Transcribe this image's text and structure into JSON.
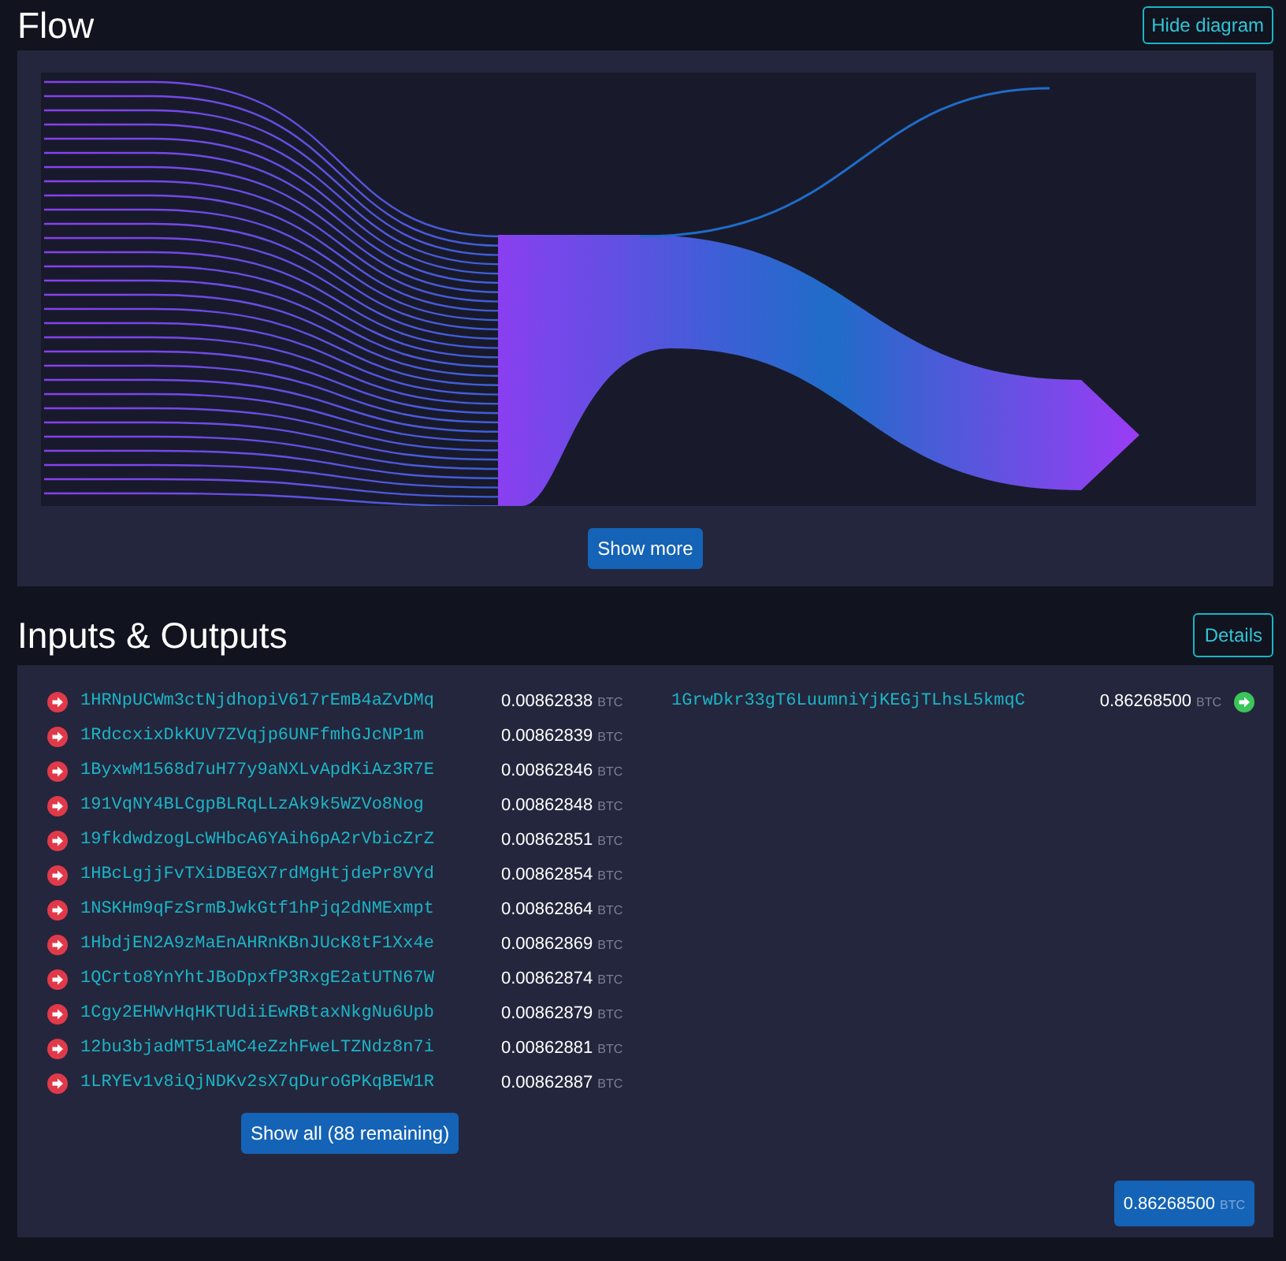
{
  "flow": {
    "title": "Flow",
    "hide_button": "Hide diagram",
    "show_more_button": "Show more"
  },
  "io": {
    "title": "Inputs & Outputs",
    "details_button": "Details",
    "inputs": [
      {
        "address": "1HRNpUCWm3ctNjdhopiV617rEmB4aZvDMq",
        "amount": "0.00862838",
        "unit": "BTC"
      },
      {
        "address": "1RdccxixDkKUV7ZVqjp6UNFfmhGJcNP1m",
        "amount": "0.00862839",
        "unit": "BTC"
      },
      {
        "address": "1ByxwM1568d7uH77y9aNXLvApdKiAz3R7E",
        "amount": "0.00862846",
        "unit": "BTC"
      },
      {
        "address": "191VqNY4BLCgpBLRqLLzAk9k5WZVo8Nog",
        "amount": "0.00862848",
        "unit": "BTC"
      },
      {
        "address": "19fkdwdzogLcWHbcA6YAih6pA2rVbicZrZ",
        "amount": "0.00862851",
        "unit": "BTC"
      },
      {
        "address": "1HBcLgjjFvTXiDBEGX7rdMgHtjdePr8VYd",
        "amount": "0.00862854",
        "unit": "BTC"
      },
      {
        "address": "1NSKHm9qFzSrmBJwkGtf1hPjq2dNMExmpt",
        "amount": "0.00862864",
        "unit": "BTC"
      },
      {
        "address": "1HbdjEN2A9zMaEnAHRnKBnJUcK8tF1Xx4e",
        "amount": "0.00862869",
        "unit": "BTC"
      },
      {
        "address": "1QCrto8YnYhtJBoDpxfP3RxgE2atUTN67W",
        "amount": "0.00862874",
        "unit": "BTC"
      },
      {
        "address": "1Cgy2EHWvHqHKTUdiiEwRBtaxNkgNu6Upb",
        "amount": "0.00862879",
        "unit": "BTC"
      },
      {
        "address": "12bu3bjadMT51aMC4eZzhFweLTZNdz8n7i",
        "amount": "0.00862881",
        "unit": "BTC"
      },
      {
        "address": "1LRYEv1v8iQjNDKv2sX7qDuroGPKqBEW1R",
        "amount": "0.00862887",
        "unit": "BTC"
      }
    ],
    "show_all_button": "Show all (88 remaining)",
    "outputs": [
      {
        "address": "1GrwDkr33gT6LuumniYjKEGjTLhsL5kmqC",
        "amount": "0.86268500",
        "unit": "BTC"
      }
    ],
    "total": {
      "amount": "0.86268500",
      "unit": "BTC"
    }
  }
}
